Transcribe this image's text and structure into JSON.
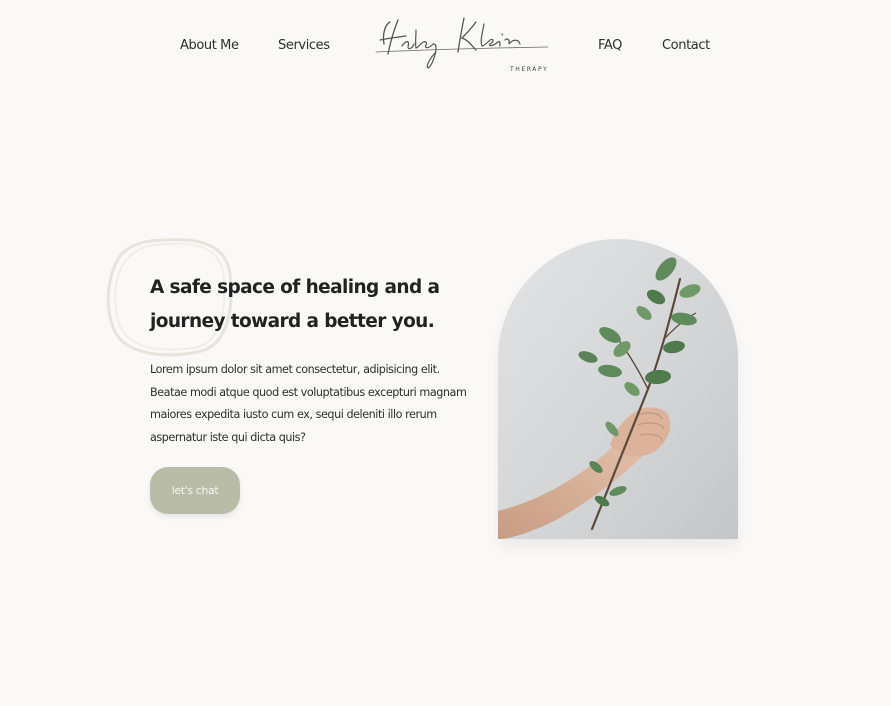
{
  "nav": {
    "left": [
      {
        "label": "About Me"
      },
      {
        "label": "Services"
      }
    ],
    "right": [
      {
        "label": "FAQ"
      },
      {
        "label": "Contact"
      }
    ]
  },
  "logo": {
    "name": "Haley Klein",
    "subtitle": "THERAPY"
  },
  "hero": {
    "headline": "A safe space of healing and a journey toward a better you.",
    "body": "Lorem ipsum dolor sit amet consectetur, adipisicing elit. Beatae modi atque quod est voluptatibus excepturi magnam maiores expedita iusto cum ex, sequi deleniti illo rerum aspernatur iste qui dicta quis?",
    "cta_label": "let's chat",
    "image_icon": "eucalyptus-branch-in-hand"
  },
  "colors": {
    "background": "#faf9f7",
    "button": "#b9bca7",
    "button_text": "#f5f5ef",
    "leaf_green": "#5f8a5c"
  }
}
